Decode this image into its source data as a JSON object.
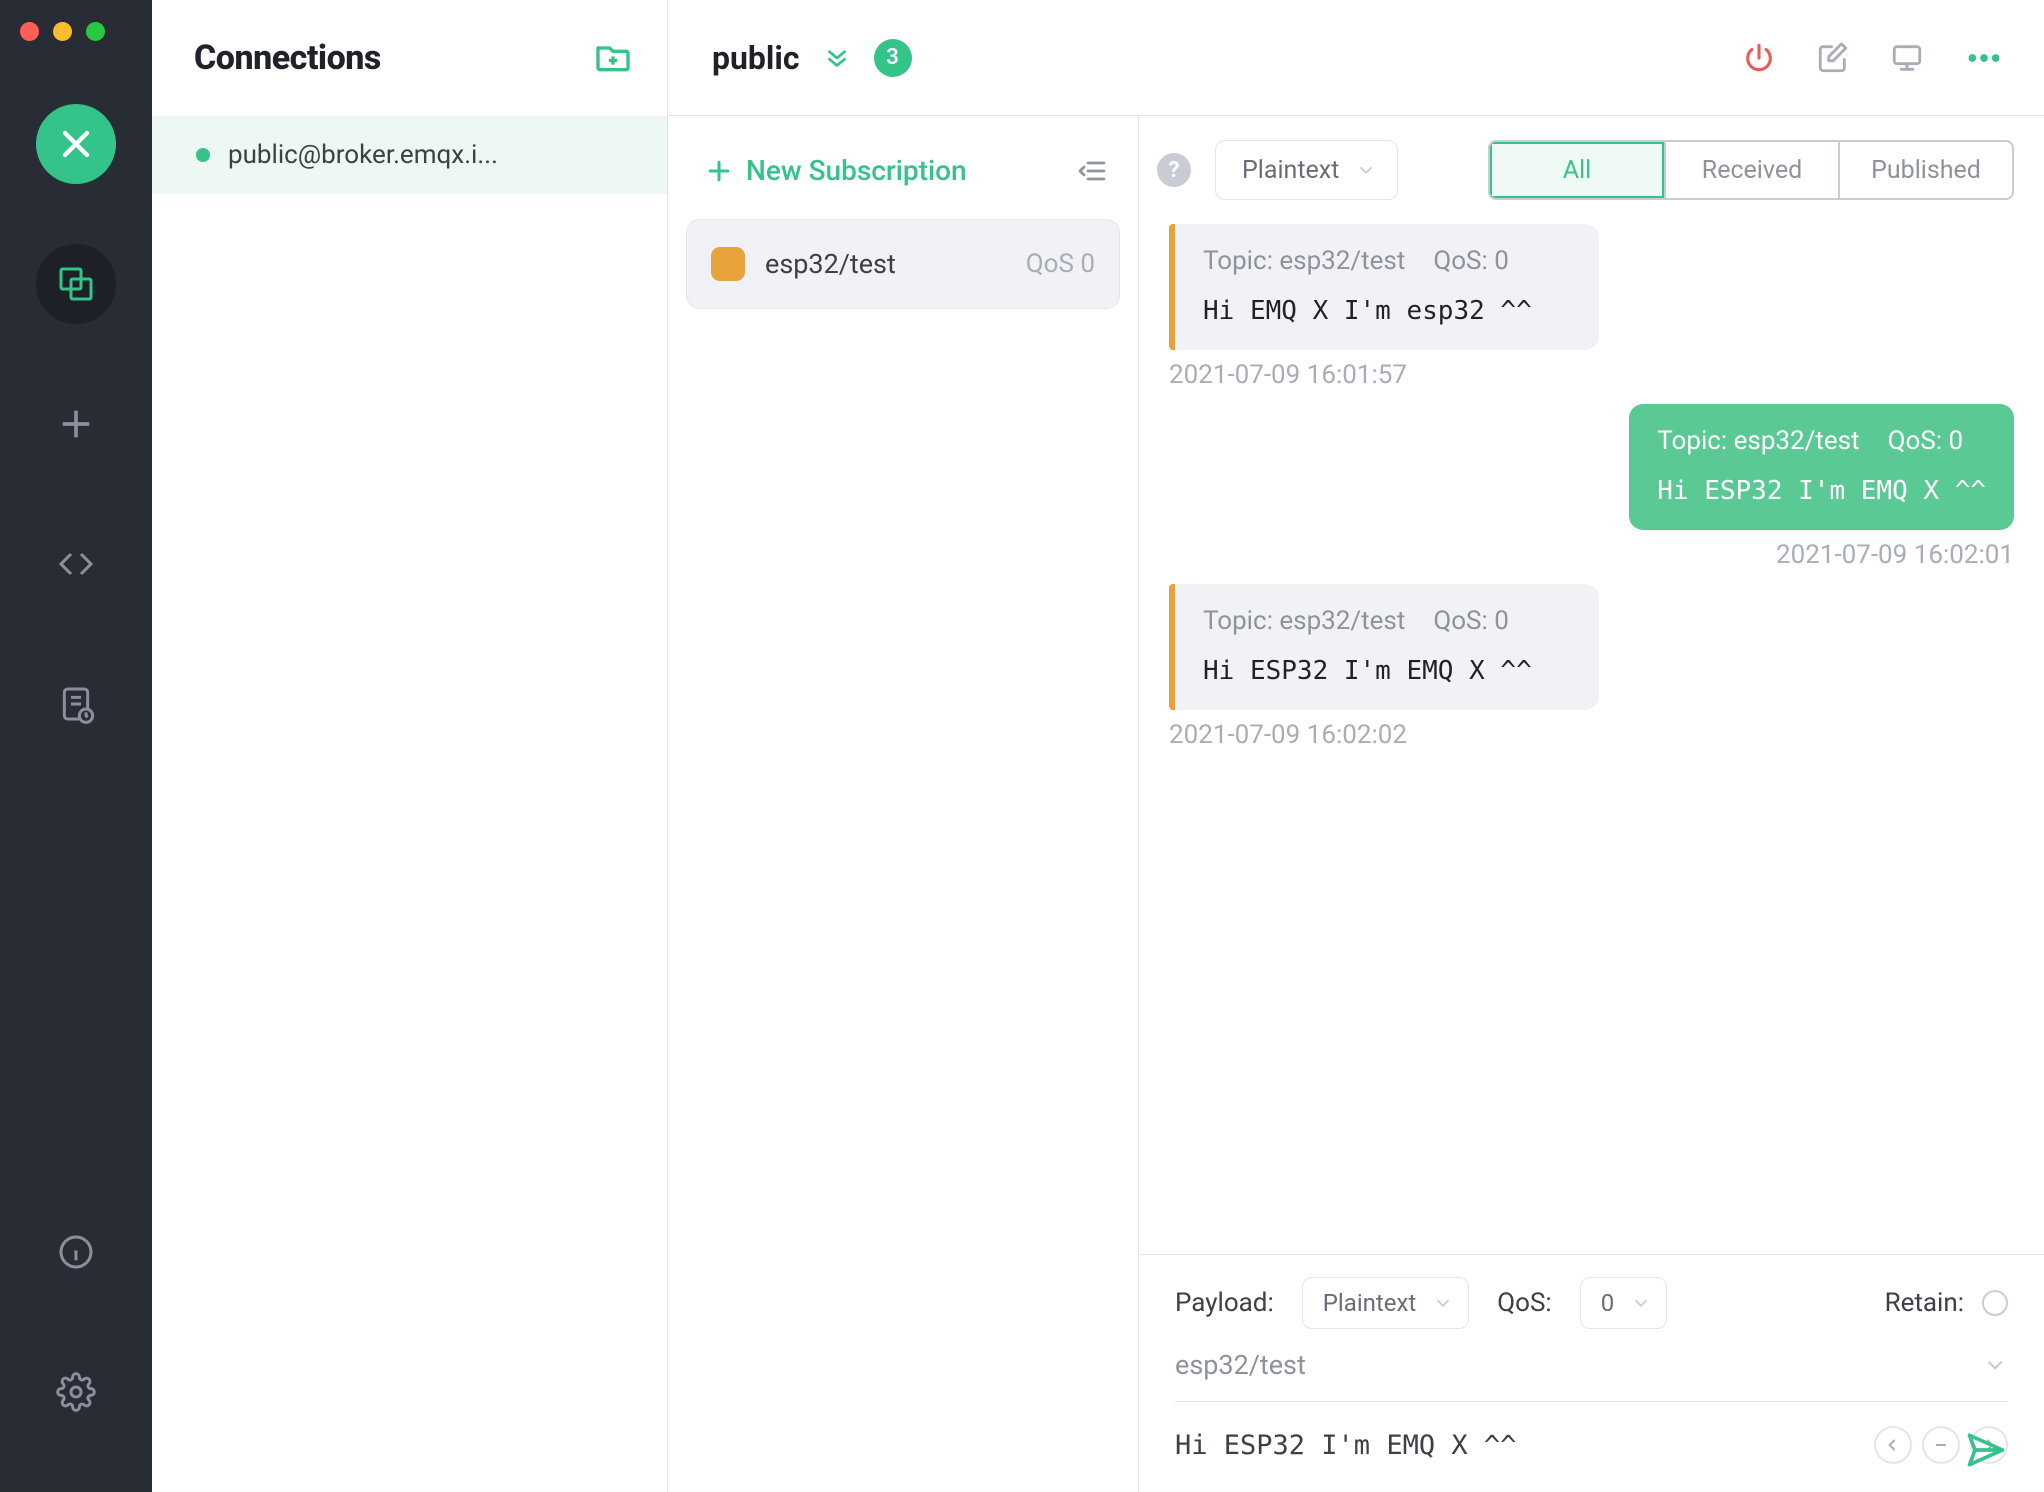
{
  "window": {
    "title": "Connections"
  },
  "rail": {
    "items": [
      "connections",
      "new",
      "scripts",
      "logs"
    ],
    "bottom": [
      "info",
      "settings"
    ]
  },
  "panel": {
    "title": "Connections",
    "connections": [
      {
        "name": "public@broker.emqx.i...",
        "status": "online"
      }
    ]
  },
  "header": {
    "connection_name": "public",
    "message_count": "3",
    "actions": [
      "power",
      "edit",
      "monitor",
      "more"
    ]
  },
  "subs": {
    "new_label": "New Subscription",
    "items": [
      {
        "topic": "esp32/test",
        "qos": "QoS 0",
        "color": "#e8a23c"
      }
    ]
  },
  "filter": {
    "format_selected": "Plaintext",
    "tabs": {
      "all": "All",
      "received": "Received",
      "published": "Published"
    },
    "active": "all"
  },
  "messages": [
    {
      "direction": "received",
      "topic_label": "Topic: esp32/test",
      "qos_label": "QoS: 0",
      "body": "Hi EMQ X I'm esp32 ^^",
      "time": "2021-07-09 16:01:57"
    },
    {
      "direction": "sent",
      "topic_label": "Topic: esp32/test",
      "qos_label": "QoS: 0",
      "body": "Hi ESP32 I'm EMQ X ^^",
      "time": "2021-07-09 16:02:01"
    },
    {
      "direction": "received",
      "topic_label": "Topic: esp32/test",
      "qos_label": "QoS: 0",
      "body": "Hi ESP32 I'm EMQ X ^^",
      "time": "2021-07-09 16:02:02"
    }
  ],
  "publish": {
    "payload_label": "Payload:",
    "format_selected": "Plaintext",
    "qos_label": "QoS:",
    "qos_selected": "0",
    "retain_label": "Retain:",
    "topic_value": "esp32/test",
    "payload_value": "Hi ESP32 I'm EMQ X ^^"
  }
}
